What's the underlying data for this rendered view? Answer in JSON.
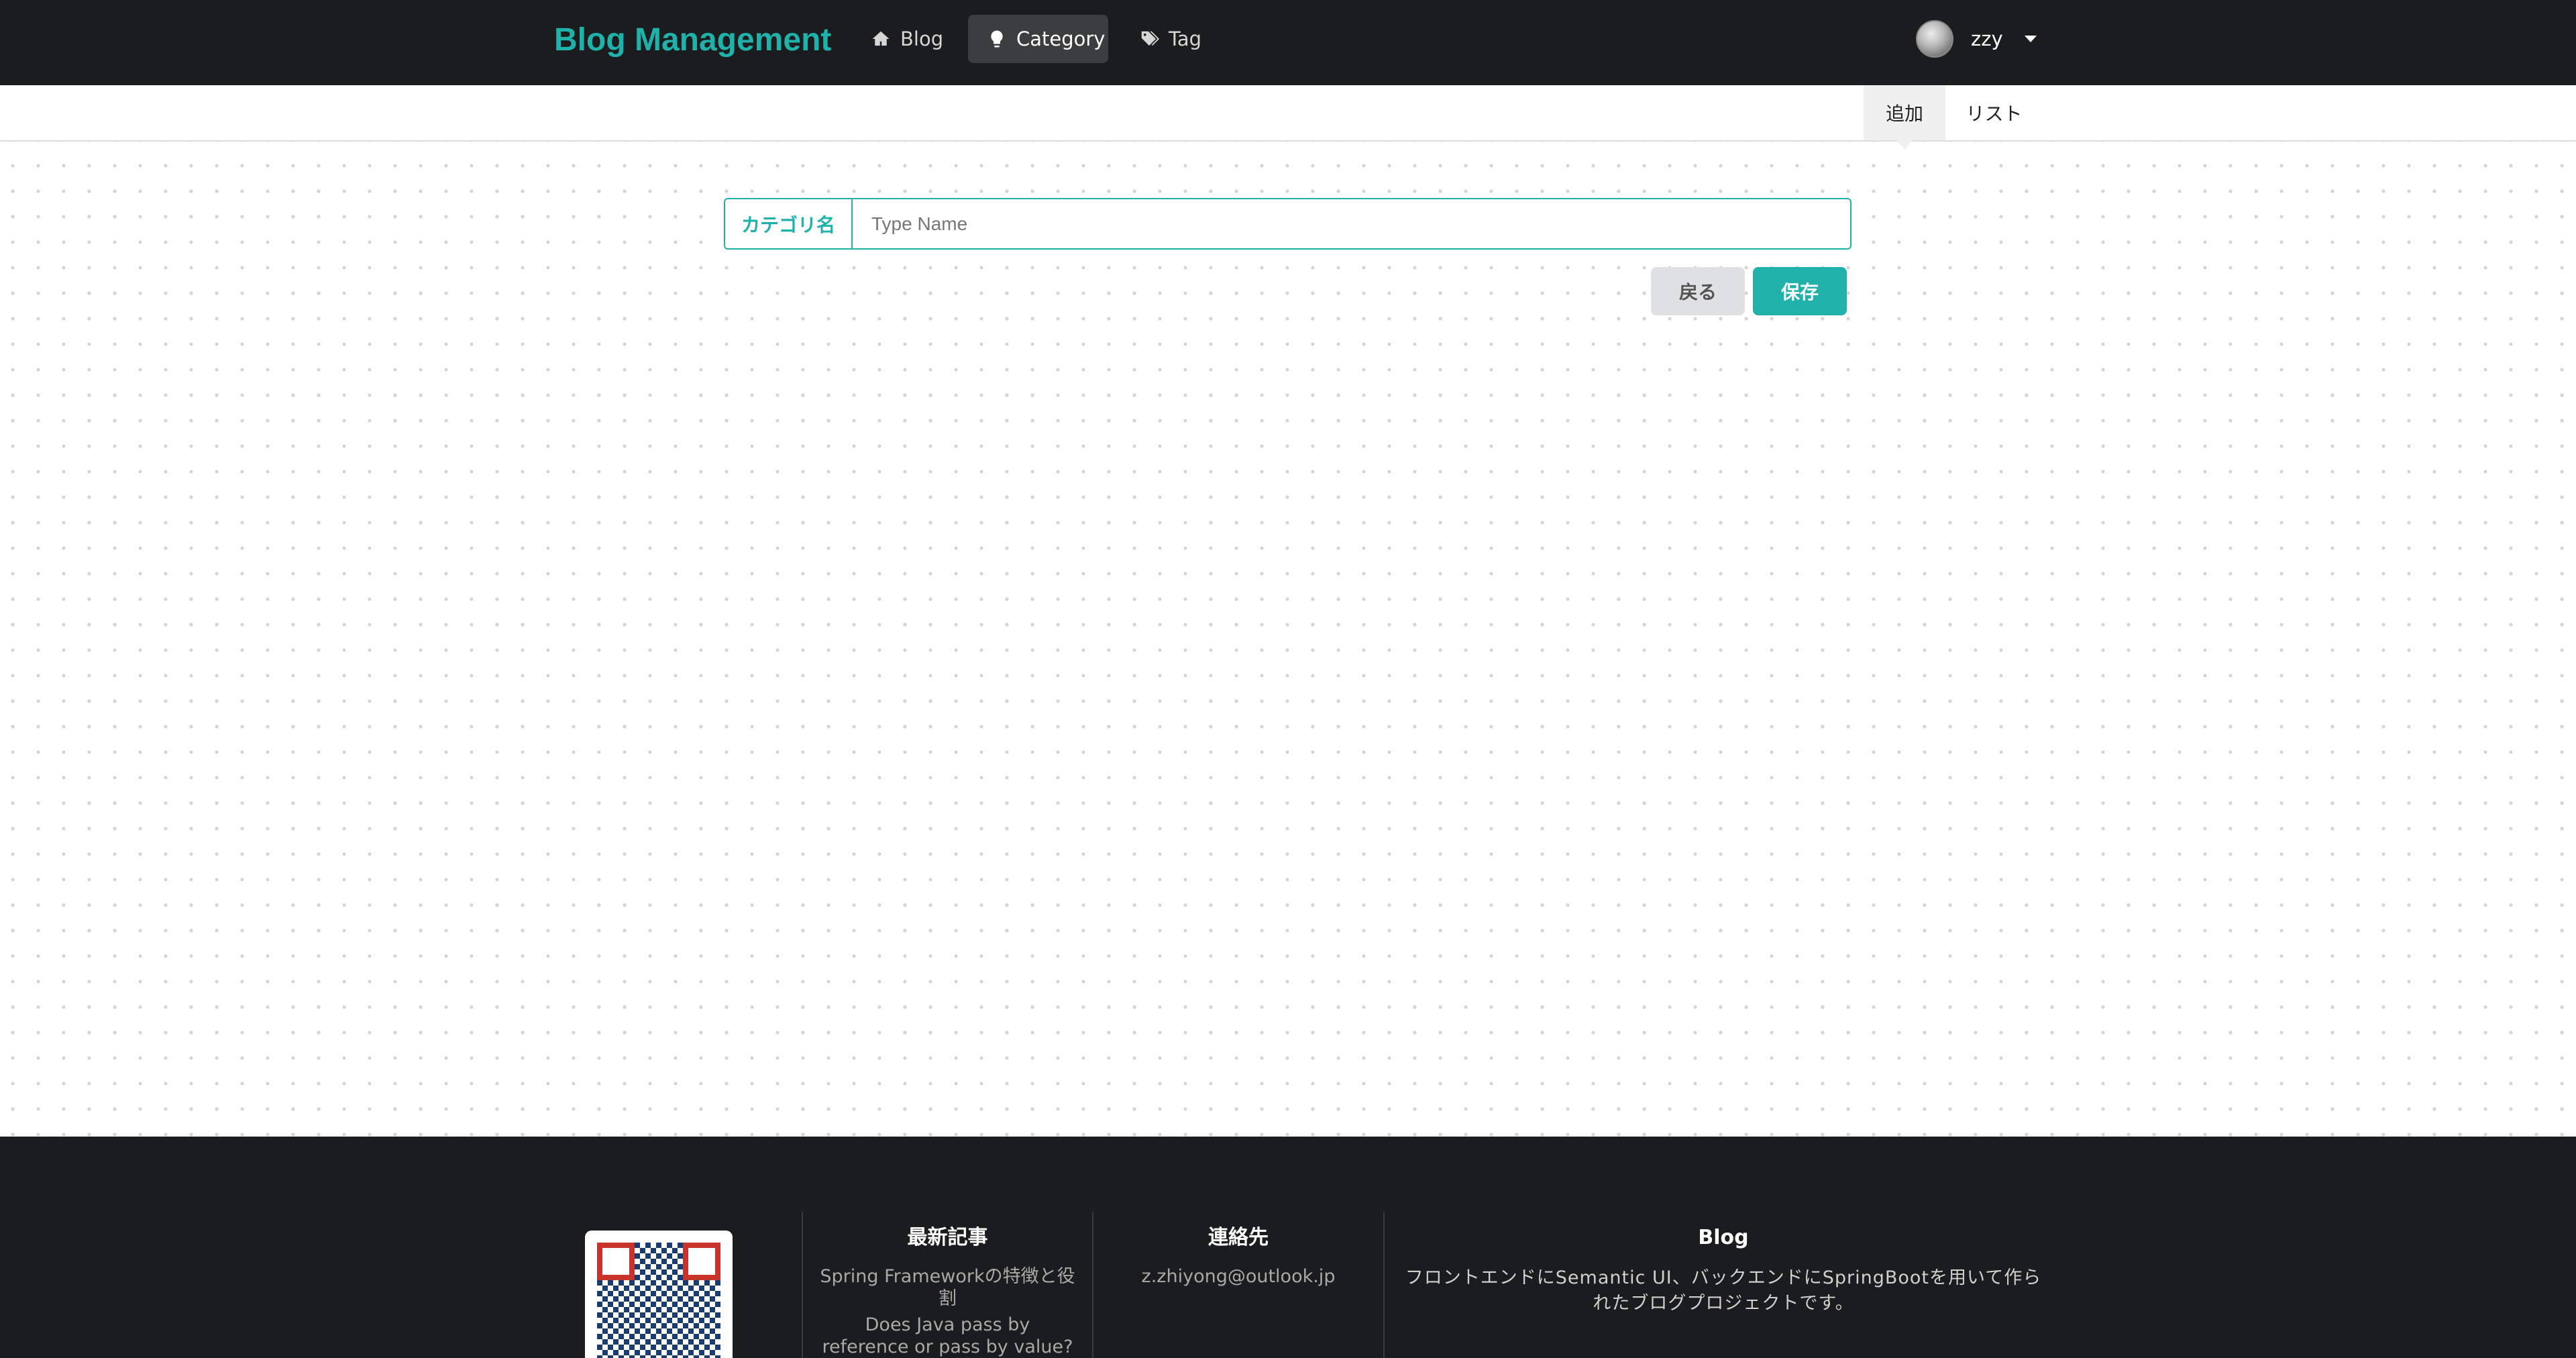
{
  "nav": {
    "brand": "Blog Management",
    "items": [
      {
        "label": "Blog",
        "icon": "home-icon"
      },
      {
        "label": "Category",
        "icon": "lightbulb-icon",
        "active": true
      },
      {
        "label": "Tag",
        "icon": "tags-icon"
      }
    ],
    "user": {
      "name": "zzy"
    }
  },
  "submenu": {
    "add_label": "追加",
    "list_label": "リスト"
  },
  "form": {
    "field_label": "カテゴリ名",
    "field_placeholder": "Type Name",
    "field_value": "",
    "back_label": "戻る",
    "save_label": "保存"
  },
  "footer": {
    "col1": {
      "title": "最新記事",
      "items": [
        "Spring Frameworkの特徴と役割",
        "Does Java pass by reference or pass by value?"
      ]
    },
    "col2": {
      "title": "連絡先",
      "email": "z.zhiyong@outlook.jp"
    },
    "col3": {
      "title": "Blog",
      "description": "フロントエンドにSemantic UI、バックエンドにSpringBootを用いて作られたブログプロジェクトです。"
    }
  },
  "colors": {
    "accent": "#20b2aa",
    "nav_bg": "#1b1c1d",
    "button_secondary": "#e0e1e2"
  }
}
